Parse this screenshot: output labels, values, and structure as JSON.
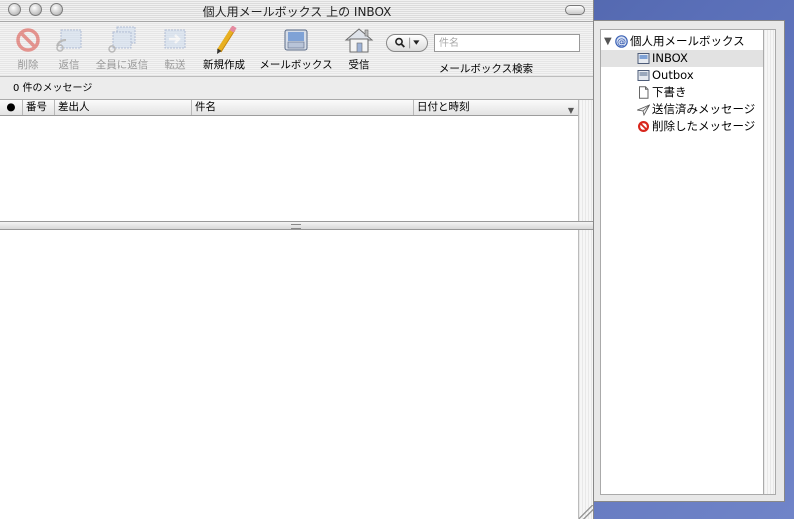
{
  "window": {
    "title": "個人用メールボックス 上の INBOX"
  },
  "toolbar": {
    "delete_label": "削除",
    "reply_label": "返信",
    "reply_all_label": "全員に返信",
    "forward_label": "転送",
    "new_message_label": "新規作成",
    "mailbox_label": "メールボックス",
    "get_mail_label": "受信",
    "search_placeholder": "件名",
    "search_label": "メールボックス検索"
  },
  "status": {
    "message_count": "0 件のメッセージ"
  },
  "columns": {
    "number": "番号",
    "from": "差出人",
    "subject": "件名",
    "date": "日付と時刻"
  },
  "drawer": {
    "root": "個人用メールボックス",
    "items": [
      {
        "label": "INBOX",
        "icon": "inbox-icon"
      },
      {
        "label": "Outbox",
        "icon": "outbox-icon"
      },
      {
        "label": "下書き",
        "icon": "drafts-icon"
      },
      {
        "label": "送信済みメッセージ",
        "icon": "sent-icon"
      },
      {
        "label": "削除したメッセージ",
        "icon": "trash-icon"
      }
    ]
  },
  "colors": {
    "desktop": "#4a5fa5",
    "delete_red": "#d8261c",
    "selection": "#e2e2e2"
  }
}
